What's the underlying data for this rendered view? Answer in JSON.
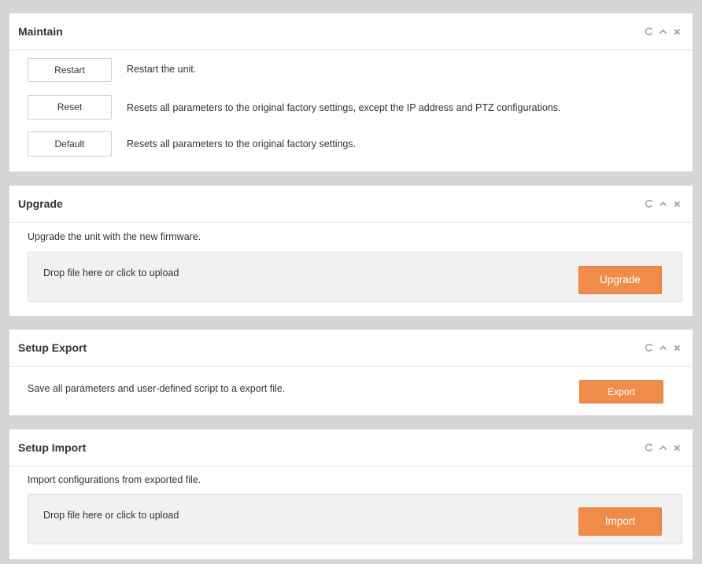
{
  "colors": {
    "accent": "#ef8c4a",
    "background": "#d6d6d6",
    "panel": "#ffffff",
    "dropzone": "#f1f1f1",
    "icon": "#9a9a9a"
  },
  "panel_tools": {
    "icons": [
      "refresh-icon",
      "chevron-up-icon",
      "close-icon"
    ]
  },
  "maintain": {
    "title": "Maintain",
    "restart_label": "Restart",
    "restart_desc": "Restart the unit.",
    "reset_label": "Reset",
    "reset_desc": "Resets all parameters to the original factory settings, except the IP address and PTZ configurations.",
    "default_label": "Default",
    "default_desc": "Resets all parameters to the original factory settings."
  },
  "upgrade": {
    "title": "Upgrade",
    "desc": "Upgrade the unit with the new firmware.",
    "dropzone_text": "Drop file here or click to upload",
    "button_label": "Upgrade"
  },
  "setup_export": {
    "title": "Setup Export",
    "desc": "Save all parameters and user-defined script to a export file.",
    "button_label": "Export"
  },
  "setup_import": {
    "title": "Setup Import",
    "desc": "Import configurations from exported file.",
    "dropzone_text": "Drop file here or click to upload",
    "button_label": "Import"
  }
}
